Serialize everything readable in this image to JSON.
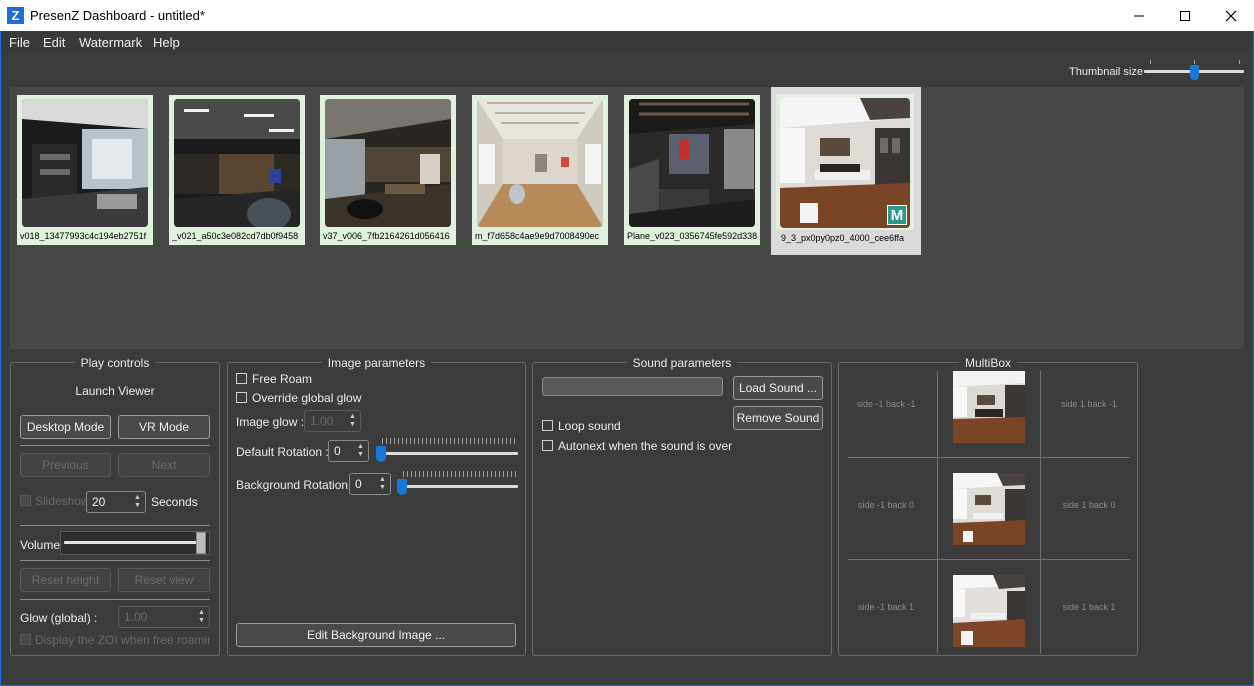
{
  "window": {
    "app_icon": "Z",
    "title": "PresenZ Dashboard - untitled*"
  },
  "menu": [
    "File",
    "Edit",
    "Watermark",
    "Help"
  ],
  "thumbnail_size": {
    "label": "Thumbnail size",
    "value": 0.5
  },
  "thumbnails": [
    {
      "name": "v018_13477993c4c194eb2751f",
      "selected": false
    },
    {
      "name": "_v021_a50c3e082cd7db0f9458",
      "selected": false
    },
    {
      "name": "v37_v006_7fb2164261d056416",
      "selected": false
    },
    {
      "name": "m_f7d658c4ae9e9d7008490ec",
      "selected": false
    },
    {
      "name": "Plane_v023_0356745fe592d338",
      "selected": false
    },
    {
      "name": "9_3_px0py0pz0_4000_cee6ffa",
      "selected": true,
      "badge": "M"
    }
  ],
  "play_controls": {
    "title": "Play controls",
    "launch_viewer": "Launch Viewer",
    "desktop_mode": "Desktop Mode",
    "vr_mode": "VR Mode",
    "previous": "Previous",
    "next": "Next",
    "slideshow": "Slideshow",
    "slideshow_seconds": "20",
    "seconds": "Seconds",
    "volume": "Volume",
    "volume_level": 0.97,
    "reset_height": "Reset height",
    "reset_view": "Reset view",
    "glow_label": "Glow (global) :",
    "glow_value": "1.00",
    "display_zoi": "Display the ZOI when free roaming"
  },
  "image_parameters": {
    "title": "Image parameters",
    "free_roam": "Free Roam",
    "override_glow": "Override global glow",
    "image_glow_label": "Image glow :",
    "image_glow_value": "1.00",
    "default_rotation_label": "Default Rotation :",
    "default_rotation_value": "0",
    "background_rotation_label": "Background Rotation :",
    "background_rotation_value": "0",
    "edit_background": "Edit Background Image ..."
  },
  "sound_parameters": {
    "title": "Sound parameters",
    "load_sound": "Load Sound ...",
    "remove_sound": "Remove Sound",
    "loop_sound": "Loop sound",
    "autonext": "Autonext when the sound is over"
  },
  "multibox": {
    "title": "MultiBox",
    "labels": {
      "r0_left": "side -1 back -1",
      "r0_right": "side 1 back -1",
      "r1_left": "side -1 back 0",
      "r1_right": "side 1 back 0",
      "r2_left": "side -1 back 1",
      "r2_right": "side 1 back 1"
    }
  },
  "colors": {
    "accent": "#1878d8",
    "frame": "#1e6fd9",
    "background": "#3c3c3c"
  }
}
